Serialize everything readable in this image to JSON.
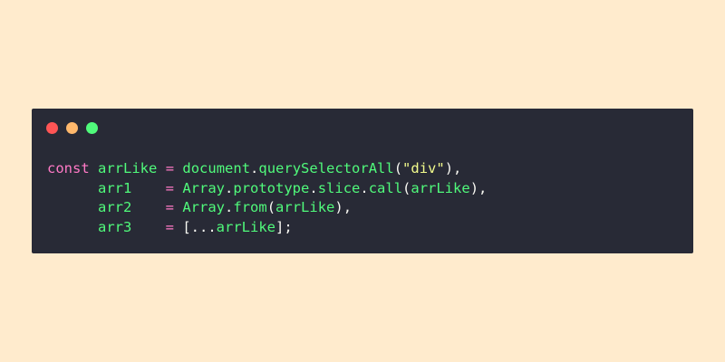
{
  "window": {
    "controls": [
      {
        "name": "close",
        "color": "#ff5555"
      },
      {
        "name": "minimize",
        "color": "#ffb86c"
      },
      {
        "name": "maximize",
        "color": "#50fa7b"
      }
    ]
  },
  "code": {
    "lines": [
      {
        "tokens": [
          {
            "t": "const",
            "c": "kw"
          },
          {
            "t": " ",
            "c": "plain"
          },
          {
            "t": "arrLike",
            "c": "var"
          },
          {
            "t": " ",
            "c": "plain"
          },
          {
            "t": "=",
            "c": "op"
          },
          {
            "t": " ",
            "c": "plain"
          },
          {
            "t": "document",
            "c": "fn"
          },
          {
            "t": ".",
            "c": "plain"
          },
          {
            "t": "querySelectorAll",
            "c": "fn"
          },
          {
            "t": "(",
            "c": "plain"
          },
          {
            "t": "\"div\"",
            "c": "str"
          },
          {
            "t": "),",
            "c": "plain"
          }
        ]
      },
      {
        "tokens": [
          {
            "t": "      ",
            "c": "plain"
          },
          {
            "t": "arr1",
            "c": "var"
          },
          {
            "t": "    ",
            "c": "plain"
          },
          {
            "t": "=",
            "c": "op"
          },
          {
            "t": " ",
            "c": "plain"
          },
          {
            "t": "Array",
            "c": "fn"
          },
          {
            "t": ".",
            "c": "plain"
          },
          {
            "t": "prototype",
            "c": "fn"
          },
          {
            "t": ".",
            "c": "plain"
          },
          {
            "t": "slice",
            "c": "fn"
          },
          {
            "t": ".",
            "c": "plain"
          },
          {
            "t": "call",
            "c": "fn"
          },
          {
            "t": "(",
            "c": "plain"
          },
          {
            "t": "arrLike",
            "c": "fn"
          },
          {
            "t": "),",
            "c": "plain"
          }
        ]
      },
      {
        "tokens": [
          {
            "t": "      ",
            "c": "plain"
          },
          {
            "t": "arr2",
            "c": "var"
          },
          {
            "t": "    ",
            "c": "plain"
          },
          {
            "t": "=",
            "c": "op"
          },
          {
            "t": " ",
            "c": "plain"
          },
          {
            "t": "Array",
            "c": "fn"
          },
          {
            "t": ".",
            "c": "plain"
          },
          {
            "t": "from",
            "c": "fn"
          },
          {
            "t": "(",
            "c": "plain"
          },
          {
            "t": "arrLike",
            "c": "fn"
          },
          {
            "t": "),",
            "c": "plain"
          }
        ]
      },
      {
        "tokens": [
          {
            "t": "      ",
            "c": "plain"
          },
          {
            "t": "arr3",
            "c": "var"
          },
          {
            "t": "    ",
            "c": "plain"
          },
          {
            "t": "=",
            "c": "op"
          },
          {
            "t": " ",
            "c": "plain"
          },
          {
            "t": "[...",
            "c": "plain"
          },
          {
            "t": "arrLike",
            "c": "fn"
          },
          {
            "t": "];",
            "c": "plain"
          }
        ]
      }
    ]
  }
}
